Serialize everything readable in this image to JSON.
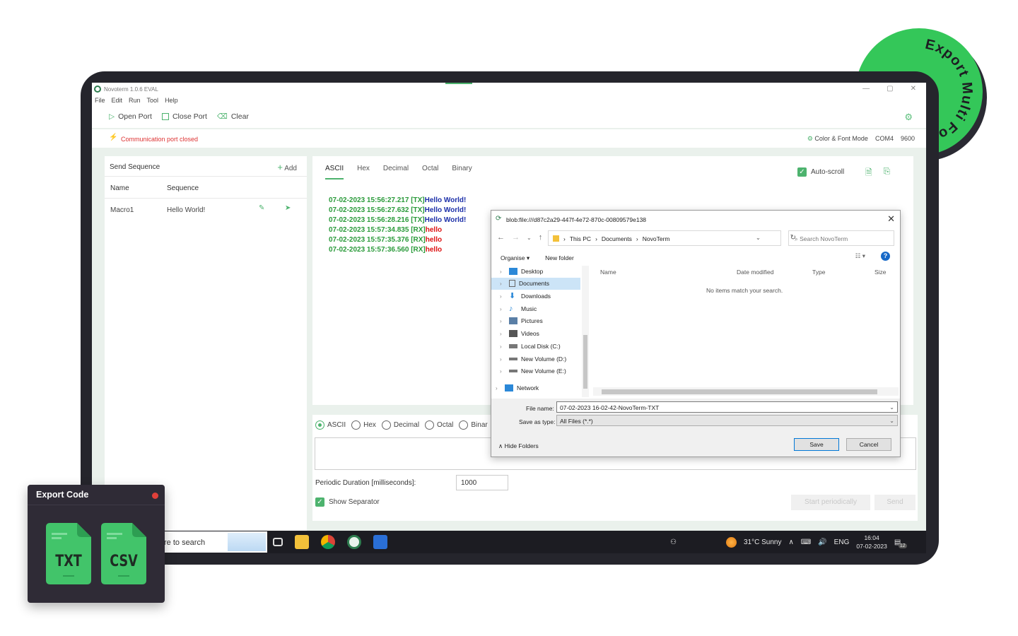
{
  "badge": {
    "text": "Export Multi Format",
    "tail": "Exp"
  },
  "app": {
    "title": "Novoterm 1.0.6 EVAL",
    "menu": [
      "File",
      "Edit",
      "Run",
      "Tool",
      "Help"
    ],
    "toolbar": {
      "open": "Open Port",
      "close": "Close Port",
      "clear": "Clear"
    },
    "status": {
      "message": "Communication port closed",
      "mode": "Color & Font Mode",
      "port": "COM4",
      "baud": "9600"
    }
  },
  "sequence": {
    "title": "Send Sequence",
    "add": "Add",
    "columns": {
      "name": "Name",
      "sequence": "Sequence"
    },
    "rows": [
      {
        "name": "Macro1",
        "sequence": "Hello World!"
      }
    ]
  },
  "receive": {
    "tabs": [
      "ASCII",
      "Hex",
      "Decimal",
      "Octal",
      "Binary"
    ],
    "autoscroll": "Auto-scroll",
    "log": [
      {
        "ts": "07-02-2023 15:56:27.217 [TX]",
        "msg": "Hello World!",
        "dir": "tx"
      },
      {
        "ts": "07-02-2023 15:56:27.632 [TX]",
        "msg": "Hello World!",
        "dir": "tx"
      },
      {
        "ts": "07-02-2023 15:56:28.216 [TX]",
        "msg": "Hello World!",
        "dir": "tx"
      },
      {
        "ts": "07-02-2023 15:57:34.835 [RX]",
        "msg": "hello",
        "dir": "rx"
      },
      {
        "ts": "07-02-2023 15:57:35.376 [RX]",
        "msg": "hello",
        "dir": "rx"
      },
      {
        "ts": "07-02-2023 15:57:36.560 [RX]",
        "msg": "hello",
        "dir": "rx"
      }
    ]
  },
  "send": {
    "formats": [
      "ASCII",
      "Hex",
      "Decimal",
      "Octal",
      "Binar"
    ],
    "periodic_label": "Periodic Duration [milliseconds]:",
    "periodic_value": "1000",
    "separator": "Show Separator",
    "start_periodic": "Start periodically",
    "send": "Send"
  },
  "dialog": {
    "title": "blob:file:///d87c2a29-447f-4e72-870c-00809579e138",
    "path": [
      "This PC",
      "Documents",
      "NovoTerm"
    ],
    "search_placeholder": "Search NovoTerm",
    "organise": "Organise",
    "new_folder": "New folder",
    "tree": [
      "Desktop",
      "Documents",
      "Downloads",
      "Music",
      "Pictures",
      "Videos",
      "Local Disk (C:)",
      "New Volume (D:)",
      "New Volume (E:)",
      "Network"
    ],
    "columns": [
      "Name",
      "Date modified",
      "Type",
      "Size"
    ],
    "empty": "No items match your search.",
    "file_name_label": "File name:",
    "file_name": "07-02-2023 16-02-42-NovoTerm-TXT",
    "save_type_label": "Save as type:",
    "save_type": "All Files (*.*)",
    "hide_folders": "Hide Folders",
    "save": "Save",
    "cancel": "Cancel"
  },
  "taskbar": {
    "search": "re to search",
    "weather": "31°C  Sunny",
    "lang": "ENG",
    "time": "16:04",
    "date": "07-02-2023",
    "notif_count": "12"
  },
  "export_card": {
    "title": "Export Code",
    "files": [
      "TXT",
      "CSV"
    ]
  },
  "colors": {
    "brand_green": "#4db36e",
    "badge_green": "#34c759",
    "tx_blue": "#1a2ea8",
    "rx_red": "#d11111"
  }
}
